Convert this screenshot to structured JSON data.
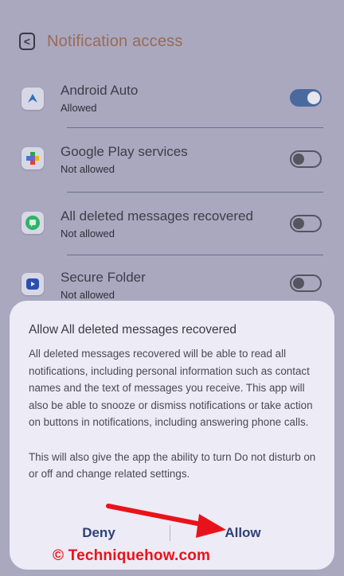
{
  "header": {
    "back_glyph": "<",
    "title": "Notification access"
  },
  "apps": [
    {
      "name": "Android Auto",
      "status": "Allowed",
      "enabled": true,
      "icon": "android-auto-icon"
    },
    {
      "name": "Google Play services",
      "status": "Not allowed",
      "enabled": false,
      "icon": "google-play-services-icon"
    },
    {
      "name": "All deleted messages recovered",
      "status": "Not allowed",
      "enabled": false,
      "icon": "message-recovery-icon"
    },
    {
      "name": "Secure Folder",
      "status": "Not allowed",
      "enabled": false,
      "icon": "secure-folder-icon"
    }
  ],
  "dialog": {
    "title": "Allow All deleted messages recovered",
    "body_1": "All deleted messages recovered will be able to read all notifications, including personal information such as contact names and the text of messages you receive. This app will also be able to snooze or dismiss notifications or take action on buttons in notifications, including answering phone calls.",
    "body_2": "This will also give the app the ability to turn Do not disturb on or off and change related settings.",
    "deny_label": "Deny",
    "allow_label": "Allow"
  },
  "watermark": "© Techniquehow.com",
  "colors": {
    "background": "#a9a8bf",
    "title": "#9b6a55",
    "toggle_on": "#4a6a9e",
    "dialog": "#ecebf6",
    "action": "#2f3f78",
    "annotation": "#e8131a"
  }
}
